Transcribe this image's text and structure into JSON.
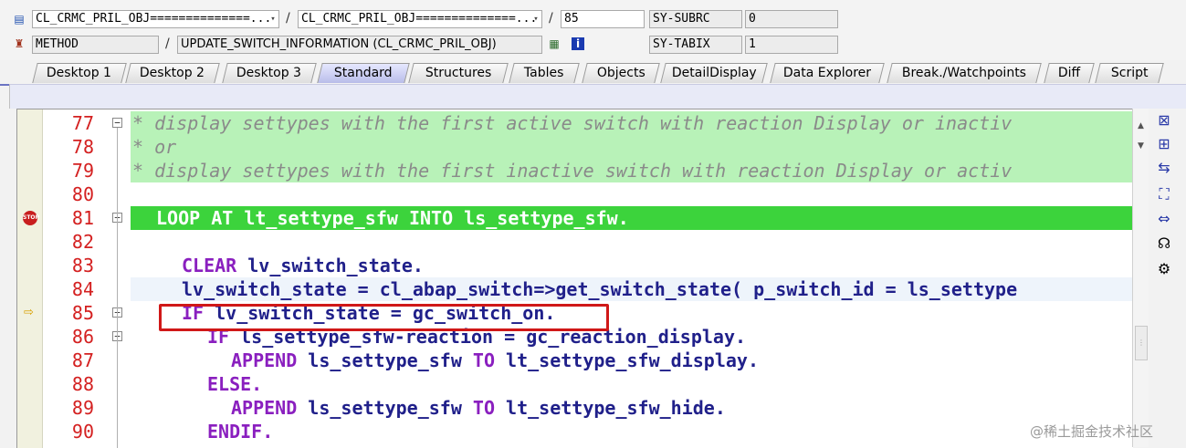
{
  "header": {
    "row1": {
      "program": "CL_CRMC_PRIL_OBJ==============...",
      "include": "CL_CRMC_PRIL_OBJ==============...",
      "line": "85",
      "var1_name": "SY-SUBRC",
      "var1_value": "0"
    },
    "row2": {
      "event_type": "METHOD",
      "event": "UPDATE_SWITCH_INFORMATION (CL_CRMC_PRIL_OBJ)",
      "var2_name": "SY-TABIX",
      "var2_value": "1"
    },
    "separator": "/"
  },
  "tabs": [
    {
      "label": "Desktop 1"
    },
    {
      "label": "Desktop 2"
    },
    {
      "label": "Desktop 3"
    },
    {
      "label": "Standard",
      "active": true
    },
    {
      "label": "Structures"
    },
    {
      "label": "Tables"
    },
    {
      "label": "Objects"
    },
    {
      "label": "DetailDisplay"
    },
    {
      "label": "Data Explorer"
    },
    {
      "label": "Break./Watchpoints"
    },
    {
      "label": "Diff"
    },
    {
      "label": "Script"
    }
  ],
  "editor": {
    "lines": [
      {
        "num": "77",
        "text": "* display settypes with the first active switch with reaction Display or inactiv"
      },
      {
        "num": "78",
        "text": "* or"
      },
      {
        "num": "79",
        "text": "* display settypes with the first inactive switch with reaction Display or activ"
      },
      {
        "num": "80",
        "text": ""
      },
      {
        "num": "81",
        "text": "LOOP AT lt_settype_sfw INTO ls_settype_sfw."
      },
      {
        "num": "82",
        "text": ""
      },
      {
        "num": "83",
        "kw": "CLEAR",
        "rest": " lv_switch_state."
      },
      {
        "num": "84",
        "text": "lv_switch_state = cl_abap_switch=>get_switch_state( p_switch_id = ls_settype"
      },
      {
        "num": "85",
        "kw": "IF",
        "rest": " lv_switch_state = gc_switch_on."
      },
      {
        "num": "86",
        "kw": "IF",
        "rest": " ls_settype_sfw-reaction = gc_reaction_display."
      },
      {
        "num": "87",
        "kw": "APPEND",
        "rest": " ls_settype_sfw ",
        "kw2": "TO",
        "rest2": " lt_settype_sfw_display."
      },
      {
        "num": "88",
        "kw": "ELSE."
      },
      {
        "num": "89",
        "kw": "APPEND",
        "rest": " ls_settype_sfw ",
        "kw2": "TO",
        "rest2": " lt_settype_sfw_hide."
      },
      {
        "num": "90",
        "kw": "ENDIF."
      }
    ]
  },
  "watermark": "@稀土掘金技术社区",
  "colors": {
    "line_number": "#d42020",
    "comment_bg": "#b8f2b8",
    "breakpoint_line_bg": "#3cd33c",
    "highlight_box": "#d01818",
    "active_tab": "#b9bde9"
  },
  "icons": {
    "program": "program-icon",
    "method": "method-icon",
    "stop": "breakpoint-stop-icon",
    "current": "current-line-arrow-icon"
  }
}
